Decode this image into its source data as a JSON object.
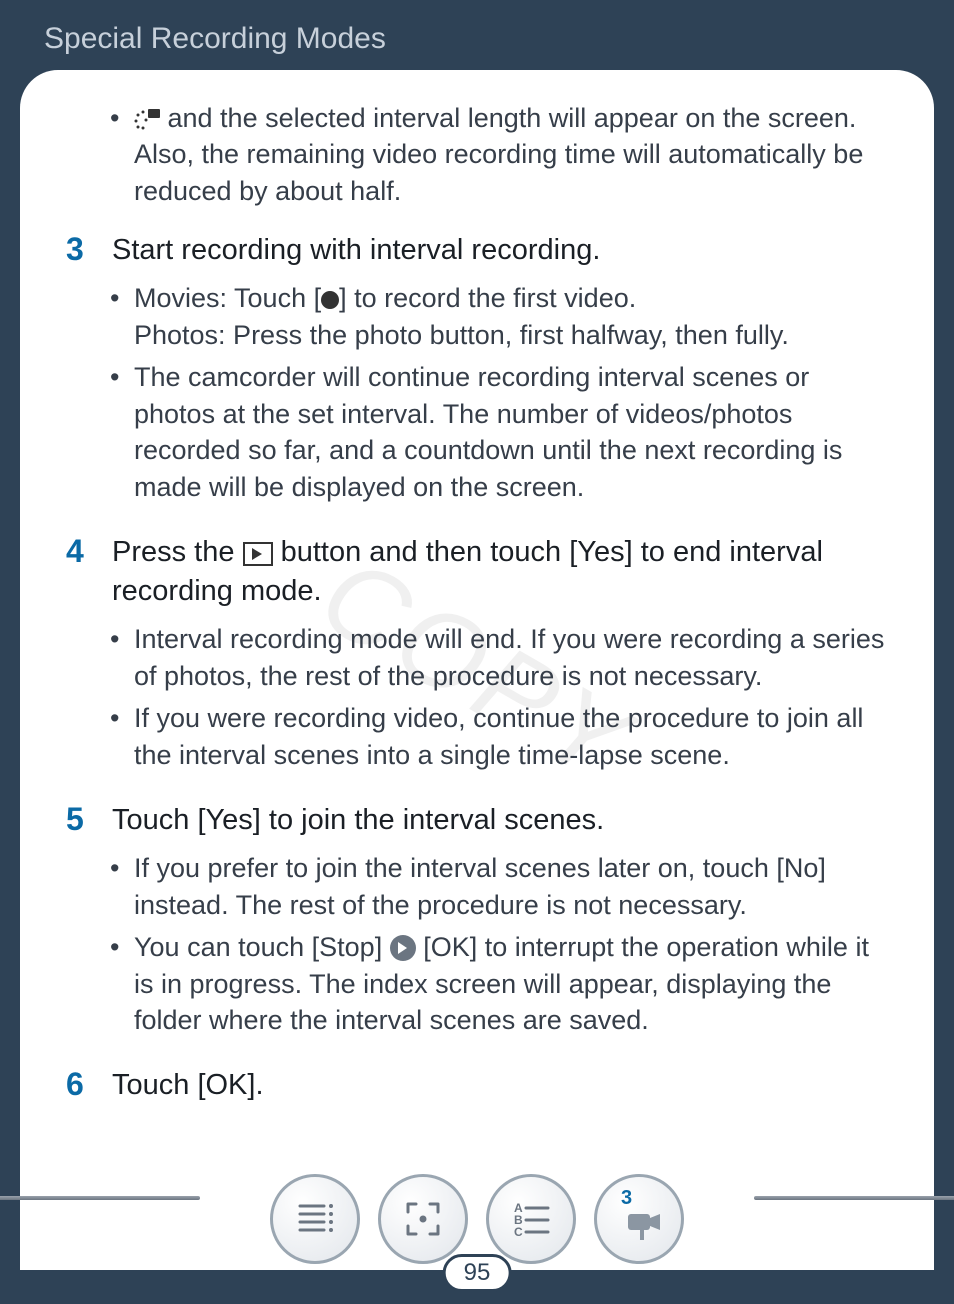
{
  "header": "Special Recording Modes",
  "page_number": "95",
  "watermark": "COPY",
  "intro_bullet": {
    "icon": "interval-icon",
    "text": " and the selected interval length will appear on the screen. Also, the remaining video recording time will automatically be reduced by about half."
  },
  "steps": [
    {
      "num": "3",
      "title": "Start recording with interval recording.",
      "bullets": [
        {
          "line1_a": "Movies: Touch [",
          "line1_b": "] to record the first video.",
          "line2": "Photos: Press the photo button, first halfway, then fully."
        },
        {
          "text": "The camcorder will continue recording interval scenes or photos at the set interval. The number of videos/photos recorded so far, and a countdown until the next recording is made will be displayed on the screen."
        }
      ]
    },
    {
      "num": "4",
      "title_a": "Press the ",
      "title_b": " button and then touch [Yes] to end interval recording mode.",
      "bullets": [
        {
          "text": "Interval recording mode will end. If you were recording a series of photos, the rest of the procedure is not necessary."
        },
        {
          "text": "If you were recording video, continue the procedure to join all the interval scenes into a single time-lapse scene."
        }
      ]
    },
    {
      "num": "5",
      "title": "Touch [Yes] to join the interval scenes.",
      "bullets": [
        {
          "text": "If you prefer to join the interval scenes later on, touch [No] instead. The rest of the procedure is not necessary."
        },
        {
          "a": "You can touch [Stop] ",
          "b": " [OK] to interrupt the operation while it is in progress. The index screen will appear, displaying the folder where the interval scenes are saved."
        }
      ]
    },
    {
      "num": "6",
      "title": "Touch [OK]."
    }
  ],
  "nav": {
    "toc": "toc-icon",
    "fullscreen": "fullscreen-icon",
    "index": "index-icon",
    "mode": "camcorder-icon",
    "mode_badge": "3"
  }
}
